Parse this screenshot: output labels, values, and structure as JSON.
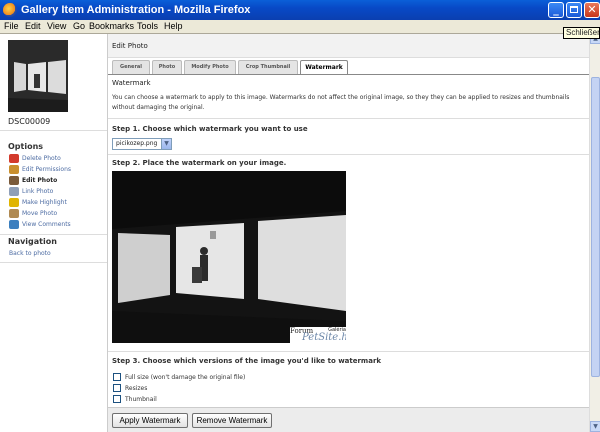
{
  "window": {
    "title": "Gallery Item Administration - Mozilla Firefox",
    "tooltip": "Schließen"
  },
  "menu": [
    "File",
    "Edit",
    "View",
    "Go",
    "Bookmarks",
    "Tools",
    "Help"
  ],
  "sidebar": {
    "thumb_caption": "DSC00009",
    "options_heading": "Options",
    "options": [
      {
        "label": "Delete Photo",
        "icon": "delete-icon",
        "color": "#d33a2c"
      },
      {
        "label": "Edit Permissions",
        "icon": "permissions-icon",
        "color": "#c98f2e"
      },
      {
        "label": "Edit Photo",
        "icon": "edit-photo-icon",
        "color": "#7a5a3a"
      },
      {
        "label": "Link Photo",
        "icon": "link-icon",
        "color": "#8f9fb8"
      },
      {
        "label": "Make Highlight",
        "icon": "highlight-icon",
        "color": "#e0b400"
      },
      {
        "label": "Move Photo",
        "icon": "move-icon",
        "color": "#b08a52"
      },
      {
        "label": "View Comments",
        "icon": "comments-icon",
        "color": "#3c7fbf"
      }
    ],
    "active_option": "Edit Photo",
    "navigation_heading": "Navigation",
    "back_link": "Back to photo"
  },
  "main": {
    "heading": "Edit Photo",
    "tabs": [
      "General",
      "Photo",
      "Modify Photo",
      "Crop Thumbnail",
      "Watermark"
    ],
    "active_tab": "Watermark",
    "section_title": "Watermark",
    "description": "You can choose a watermark to apply to this image. Watermarks do not affect the original image, so they they can be applied to resizes and thumbnails without damaging the original.",
    "step1": "Step 1. Choose which watermark you want to use",
    "watermark_select": "picikozep.png",
    "step2": "Step 2. Place the watermark on your image.",
    "watermark_text": [
      "Forum",
      "PetSite.hu",
      "Galéria"
    ],
    "step3": "Step 3. Choose which versions of the image you'd like to watermark",
    "versions": [
      {
        "label": "Full size (won't damage the original file)",
        "checked": false
      },
      {
        "label": "Resizes",
        "checked": false
      },
      {
        "label": "Thumbnail",
        "checked": false
      }
    ],
    "buttons": {
      "apply": "Apply Watermark",
      "remove": "Remove Watermark"
    }
  },
  "colors": {
    "titlebar": "#0a4fd0",
    "link": "#4c6ba2",
    "tab_active_border": "#888888"
  }
}
